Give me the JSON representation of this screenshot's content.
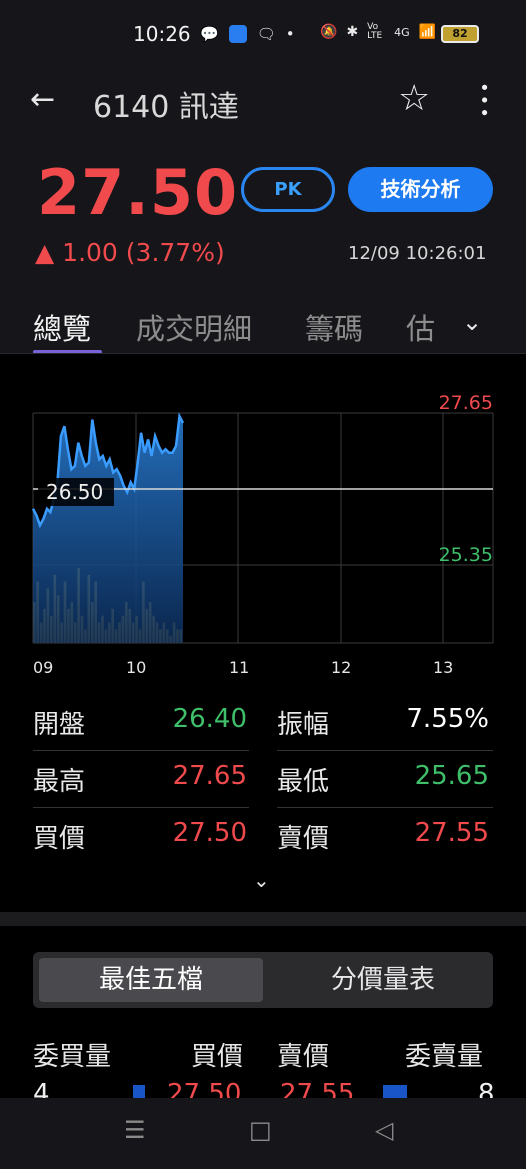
{
  "status_bar": {
    "time": "10:26",
    "icons": [
      "chat-bubble-icon",
      "app-icon",
      "message-icon",
      "dot-icon"
    ],
    "right_icons": [
      "mute-icon",
      "bluetooth-icon",
      "volte-icon",
      "signal-icon"
    ],
    "volte_label": "Vo LTE",
    "network_label": "4G",
    "battery": "82"
  },
  "header": {
    "title": "6140 訊達",
    "price": "27.50",
    "pk_label": "PK",
    "technical_label": "技術分析",
    "change": "▲ 1.00 (3.77%)",
    "timestamp": "12/09 10:26:01",
    "accent_red": "#f04a4d",
    "accent_blue": "#1e7af0"
  },
  "tabs": [
    {
      "label": "總覽",
      "active": true
    },
    {
      "label": "成交明細",
      "active": false
    },
    {
      "label": "籌碼",
      "active": false
    },
    {
      "label": "估",
      "active": false
    }
  ],
  "chart_data": {
    "type": "line",
    "y_high_label": "27.65",
    "y_low_label": "25.35",
    "reference_label": "26.50",
    "x_tick_labels": [
      "09",
      "10",
      "11",
      "12",
      "13"
    ],
    "ylim": [
      25.35,
      27.65
    ],
    "reference": 26.5,
    "price_series": [
      26.2,
      26.1,
      25.95,
      26.05,
      26.2,
      26.15,
      26.35,
      26.6,
      27.3,
      27.45,
      27.1,
      26.8,
      26.85,
      27.2,
      27.0,
      26.85,
      26.9,
      27.55,
      27.2,
      26.95,
      27.0,
      26.85,
      26.95,
      26.75,
      26.8,
      26.7,
      26.55,
      26.45,
      26.6,
      26.5,
      26.9,
      27.35,
      27.05,
      27.25,
      27.0,
      27.3,
      27.15,
      27.05,
      27.1,
      27.05,
      27.05,
      27.15,
      27.6,
      27.5
    ],
    "volume_series": [
      6,
      9,
      3,
      5,
      8,
      4,
      10,
      7,
      3,
      9,
      5,
      6,
      3,
      11,
      4,
      2,
      10,
      6,
      9,
      3,
      4,
      2,
      3,
      5,
      2,
      3,
      4,
      6,
      5,
      3,
      4,
      2,
      9,
      5,
      6,
      4,
      3,
      2,
      3,
      2,
      1,
      3,
      2,
      2
    ]
  },
  "quote_rows": [
    {
      "left_label": "開盤",
      "left_value": "26.40",
      "left_color": "#3fbf6a",
      "right_label": "振幅",
      "right_value": "7.55%",
      "right_color": "#ffffff"
    },
    {
      "left_label": "最高",
      "left_value": "27.65",
      "left_color": "#f04a4d",
      "right_label": "最低",
      "right_value": "25.65",
      "right_color": "#3fbf6a"
    },
    {
      "left_label": "買價",
      "left_value": "27.50",
      "left_color": "#f04a4d",
      "right_label": "賣價",
      "right_value": "27.55",
      "right_color": "#f04a4d"
    }
  ],
  "segment": {
    "active": "最佳五檔",
    "inactive": "分價量表"
  },
  "order_book": {
    "headers": [
      "委買量",
      "買價",
      "賣價",
      "委賣量"
    ],
    "first_row": {
      "bid_qty": "4",
      "bid_price": "27.50",
      "ask_price": "27.55",
      "ask_qty": "8"
    }
  },
  "nav": {
    "recent": "☰",
    "home": "□",
    "back": "◁"
  }
}
